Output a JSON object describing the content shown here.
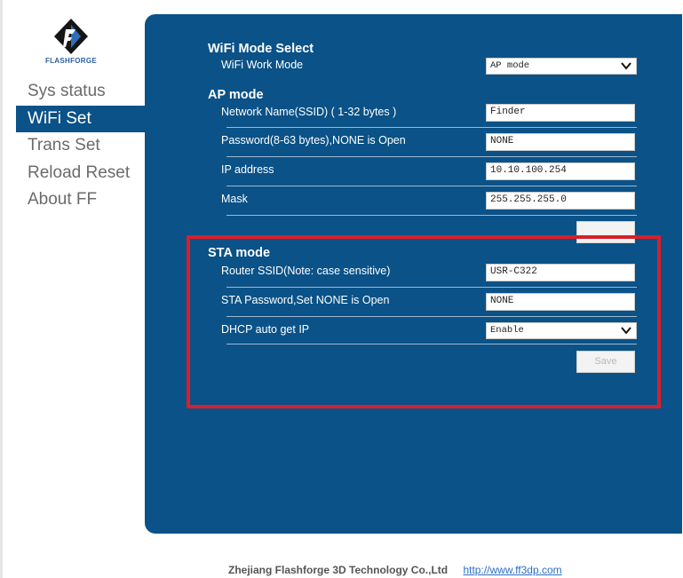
{
  "logo": {
    "text": "FLASHFORGE"
  },
  "sidebar": {
    "items": [
      {
        "label": "Sys status",
        "active": false
      },
      {
        "label": "WiFi Set",
        "active": true
      },
      {
        "label": "Trans Set",
        "active": false
      },
      {
        "label": "Reload Reset",
        "active": false
      },
      {
        "label": "About FF",
        "active": false
      }
    ]
  },
  "wifi_mode": {
    "title": "WiFi Mode Select",
    "work_mode_label": "WiFi Work Mode",
    "work_mode_value": "AP mode"
  },
  "ap_mode": {
    "title": "AP mode",
    "ssid_label": "Network Name(SSID) ( 1-32 bytes )",
    "ssid_value": "Finder",
    "password_label": "Password(8-63 bytes),NONE is Open",
    "password_value": "NONE",
    "ip_label": "IP address",
    "ip_value": "10.10.100.254",
    "mask_label": "Mask",
    "mask_value": "255.255.255.0"
  },
  "sta_mode": {
    "title": "STA mode",
    "router_ssid_label": "Router SSID(Note: case sensitive)",
    "router_ssid_value": "USR-C322",
    "password_label": "STA Password,Set NONE is Open",
    "password_value": "NONE",
    "dhcp_label": "DHCP auto get IP",
    "dhcp_value": "Enable",
    "save_label": "Save"
  },
  "footer": {
    "company": "Zhejiang Flashforge 3D Technology Co.,Ltd",
    "link": "http://www.ff3dp.com"
  },
  "colors": {
    "panel": "#0a5287",
    "highlight": "#d81f2a",
    "link": "#2b6ec7"
  }
}
